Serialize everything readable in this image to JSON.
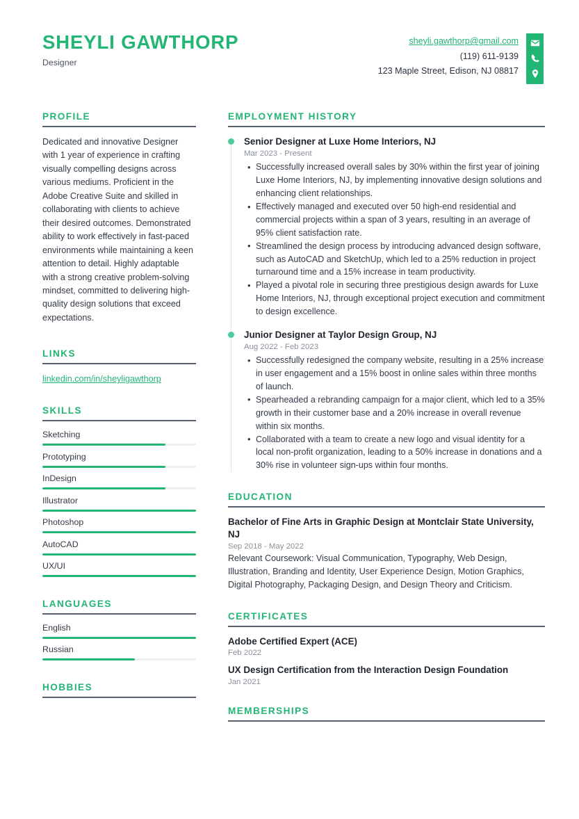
{
  "header": {
    "name": "SHEYLI GAWTHORP",
    "job_title": "Designer",
    "email": "sheyli.gawthorp@gmail.com",
    "phone": "(119) 611-9139",
    "address": "123 Maple Street, Edison, NJ 08817",
    "icons": [
      "envelope-icon",
      "phone-icon",
      "location-pin-icon"
    ]
  },
  "colors": {
    "accent": "#22b573",
    "dot": "#4ecb9b",
    "rule": "#55606e",
    "body_text": "#333a47",
    "muted_text": "#8a9099",
    "track": "#edeeee"
  },
  "left": {
    "profile": {
      "title": "PROFILE",
      "text": "Dedicated and innovative Designer with 1 year of experience\nin crafting visually compelling designs across various mediums. Proficient in the Adobe Creative Suite and skilled in collaborating with clients to achieve their desired outcomes. Demonstrated ability to work effectively in fast-paced environments while maintaining a keen attention to detail. Highly adaptable with a strong creative problem-solving mindset, committed to delivering high-quality design solutions that exceed expectations."
    },
    "links": {
      "title": "LINKS",
      "items": [
        {
          "label": "linkedin.com/in/sheyligawthorp"
        }
      ]
    },
    "skills": {
      "title": "SKILLS",
      "items": [
        {
          "label": "Sketching",
          "level": 80
        },
        {
          "label": "Prototyping",
          "level": 80
        },
        {
          "label": "InDesign",
          "level": 80
        },
        {
          "label": "Illustrator",
          "level": 100
        },
        {
          "label": "Photoshop",
          "level": 100
        },
        {
          "label": "AutoCAD",
          "level": 100
        },
        {
          "label": "UX/UI",
          "level": 100
        }
      ]
    },
    "languages": {
      "title": "LANGUAGES",
      "items": [
        {
          "label": "English",
          "level": 100
        },
        {
          "label": "Russian",
          "level": 60
        }
      ]
    },
    "hobbies": {
      "title": "HOBBIES"
    }
  },
  "right": {
    "employment": {
      "title": "EMPLOYMENT HISTORY",
      "jobs": [
        {
          "role": "Senior Designer at Luxe Home Interiors, NJ",
          "date": "Mar 2023 - Present",
          "bullets": [
            "Successfully increased overall sales by 30% within the first year of joining Luxe Home Interiors, NJ, by implementing innovative design solutions and enhancing client relationships.",
            "Effectively managed and executed over 50 high-end residential and commercial projects within a span of 3 years, resulting in an average of 95% client satisfaction rate.",
            "Streamlined the design process by introducing advanced design software, such as AutoCAD and SketchUp, which led to a 25% reduction in project turnaround time and a 15% increase in team productivity.",
            "Played a pivotal role in securing three prestigious design awards for Luxe Home Interiors, NJ, through exceptional project execution and commitment to design excellence."
          ]
        },
        {
          "role": "Junior Designer at Taylor Design Group, NJ",
          "date": "Aug 2022 - Feb 2023",
          "bullets": [
            "Successfully redesigned the company website, resulting in a 25% increase in user engagement and a 15% boost in online sales within three months of launch.",
            "Spearheaded a rebranding campaign for a major client, which led to a 35% growth in their customer base and a 20% increase in overall revenue within six months.",
            "Collaborated with a team to create a new logo and visual identity for a local non-profit organization, leading to a 50% increase in donations and a 30% rise in volunteer sign-ups within four months."
          ]
        }
      ]
    },
    "education": {
      "title": "EDUCATION",
      "entries": [
        {
          "degree": "Bachelor of Fine Arts in Graphic Design at Montclair State University, NJ",
          "date": "Sep 2018 - May 2022",
          "description": "Relevant Coursework: Visual Communication, Typography, Web Design, Illustration, Branding and Identity, User Experience Design, Motion Graphics, Digital Photography, Packaging Design, and Design Theory and Criticism."
        }
      ]
    },
    "certificates": {
      "title": "CERTIFICATES",
      "entries": [
        {
          "name": "Adobe Certified Expert (ACE)",
          "date": "Feb 2022"
        },
        {
          "name": "UX Design Certification from the Interaction Design Foundation",
          "date": "Jan 2021"
        }
      ]
    },
    "memberships": {
      "title": "MEMBERSHIPS"
    }
  }
}
